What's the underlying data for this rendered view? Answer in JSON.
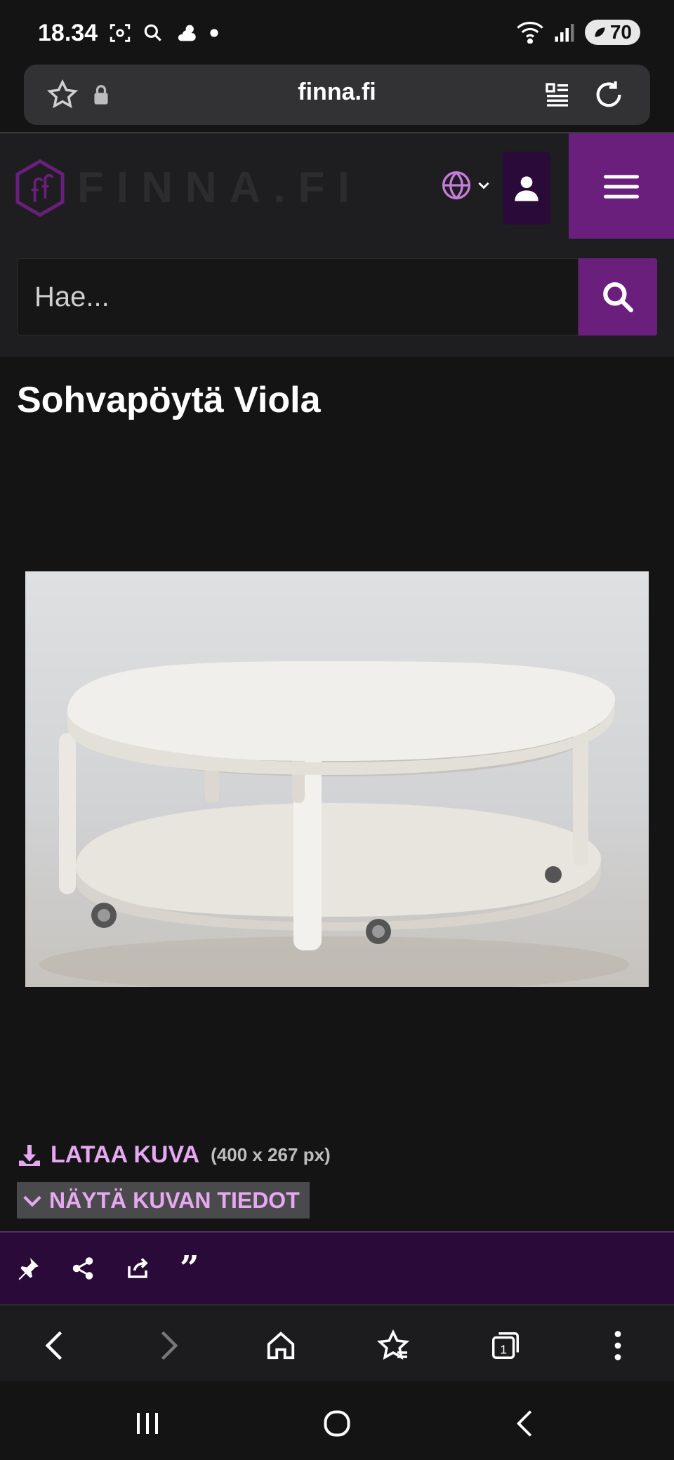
{
  "status": {
    "time": "18.34",
    "battery": "70"
  },
  "browser": {
    "url": "finna.fi"
  },
  "header": {
    "logo_text": "FINNA.FI"
  },
  "search": {
    "placeholder": "Hae..."
  },
  "record": {
    "title": "Sohvapöytä Viola",
    "download_label": "LATAA KUVA",
    "image_size": "(400 x 267 px)",
    "details_label": "NÄYTÄ KUVAN TIEDOT"
  },
  "colors": {
    "brand": "#6a1f7d",
    "brand_dark": "#2a0a38",
    "link": "#e6a8f0",
    "background": "#141415"
  }
}
